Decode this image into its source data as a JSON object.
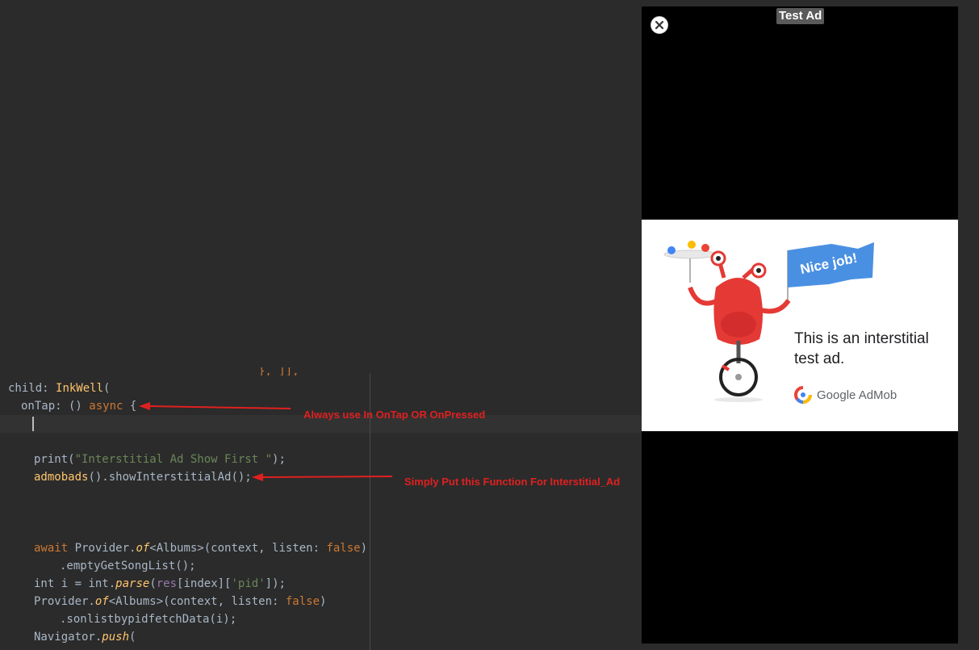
{
  "editor": {
    "partial_top": "}, ]],",
    "lines": {
      "l1_a": "child: ",
      "l1_b": "InkWell",
      "l1_c": "(",
      "l2_a": "onTap: () ",
      "l2_b": "async",
      "l2_c": " {",
      "l4_a": "print(",
      "l4_b": "\"Interstitial Ad Show First \"",
      "l4_c": ");",
      "l5_a": "admobads",
      "l5_b": "().showInterstitialAd();",
      "l6_a": "await ",
      "l6_b": "Provider.",
      "l6_c": "of",
      "l6_d": "<Albums>(context, ",
      "l6_e": "listen: ",
      "l6_f": "false",
      "l6_g": ")",
      "l7": ".emptyGetSongList();",
      "l8_a": "int i = int.",
      "l8_b": "parse",
      "l8_c": "(",
      "l8_d": "res",
      "l8_e": "[index][",
      "l8_f": "'pid'",
      "l8_g": "]);",
      "l9_a": "Provider.",
      "l9_b": "of",
      "l9_c": "<Albums>(context, ",
      "l9_d": "listen: ",
      "l9_e": "false",
      "l9_f": ")",
      "l10": ".sonlistbypidfetchData(i);",
      "l11_a": "Navigator.",
      "l11_b": "push",
      "l11_c": "("
    }
  },
  "annotations": {
    "first": "Always use In OnTap OR OnPressed",
    "second": "Simply Put this Function For Interstitial_Ad",
    "color": "#e02020"
  },
  "ad": {
    "label": "Test Ad",
    "close_icon": "close-icon",
    "flag_text": "Nice job!",
    "message": "This is an interstitial test ad.",
    "brand": "Google AdMob"
  }
}
